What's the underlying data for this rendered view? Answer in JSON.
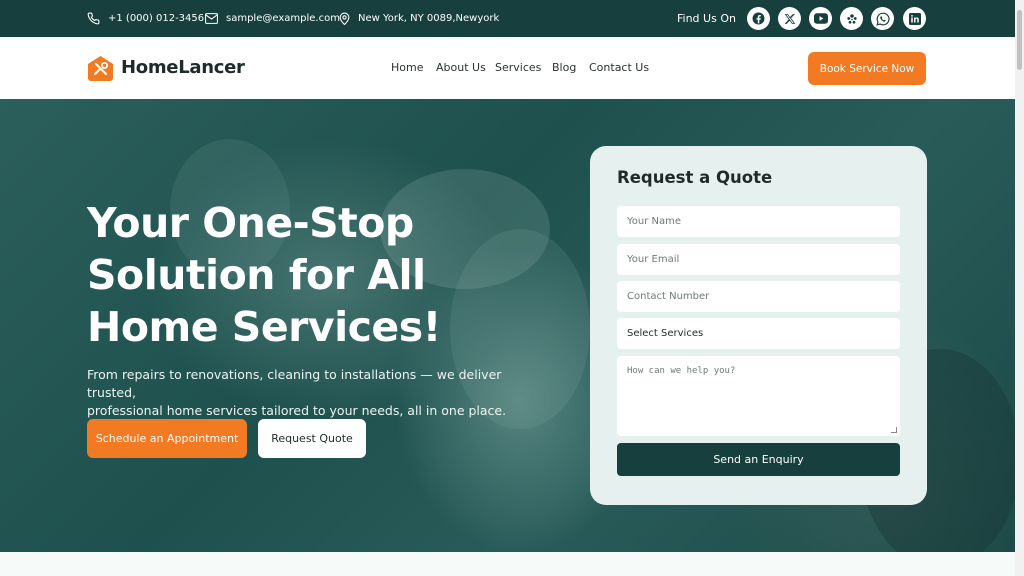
{
  "topbar": {
    "phone": "+1 (000) 012-3456",
    "email": "sample@example.com",
    "address": "New York, NY 0089,Newyork",
    "find_label": "Find Us On",
    "socials": [
      "facebook-icon",
      "x-icon",
      "youtube-icon",
      "yelp-icon",
      "whatsapp-icon",
      "linkedin-icon"
    ]
  },
  "nav": {
    "brand": "HomeLancer",
    "menu": [
      "Home",
      "About Us",
      "Services",
      "Blog",
      "Contact Us"
    ],
    "cta": "Book Service Now"
  },
  "hero": {
    "title_line1": "Your One-Stop",
    "title_line2": "Solution for All",
    "title_line3": "Home Services!",
    "subtitle_line1": "From repairs to renovations, cleaning to installations — we deliver trusted,",
    "subtitle_line2": "professional home services tailored to your needs, all in one place.",
    "primary_button": "Schedule an Appointment",
    "secondary_button": "Request Quote"
  },
  "quote_form": {
    "title": "Request a Quote",
    "name_placeholder": "Your Name",
    "email_placeholder": "Your Email",
    "contact_placeholder": "Contact Number",
    "services_select": "Select Services",
    "message_placeholder": "How can we help you?",
    "submit": "Send an Enquiry"
  },
  "colors": {
    "primary_dark": "#163f3d",
    "accent_orange": "#f27a22",
    "card_bg": "#e6f1ef"
  }
}
